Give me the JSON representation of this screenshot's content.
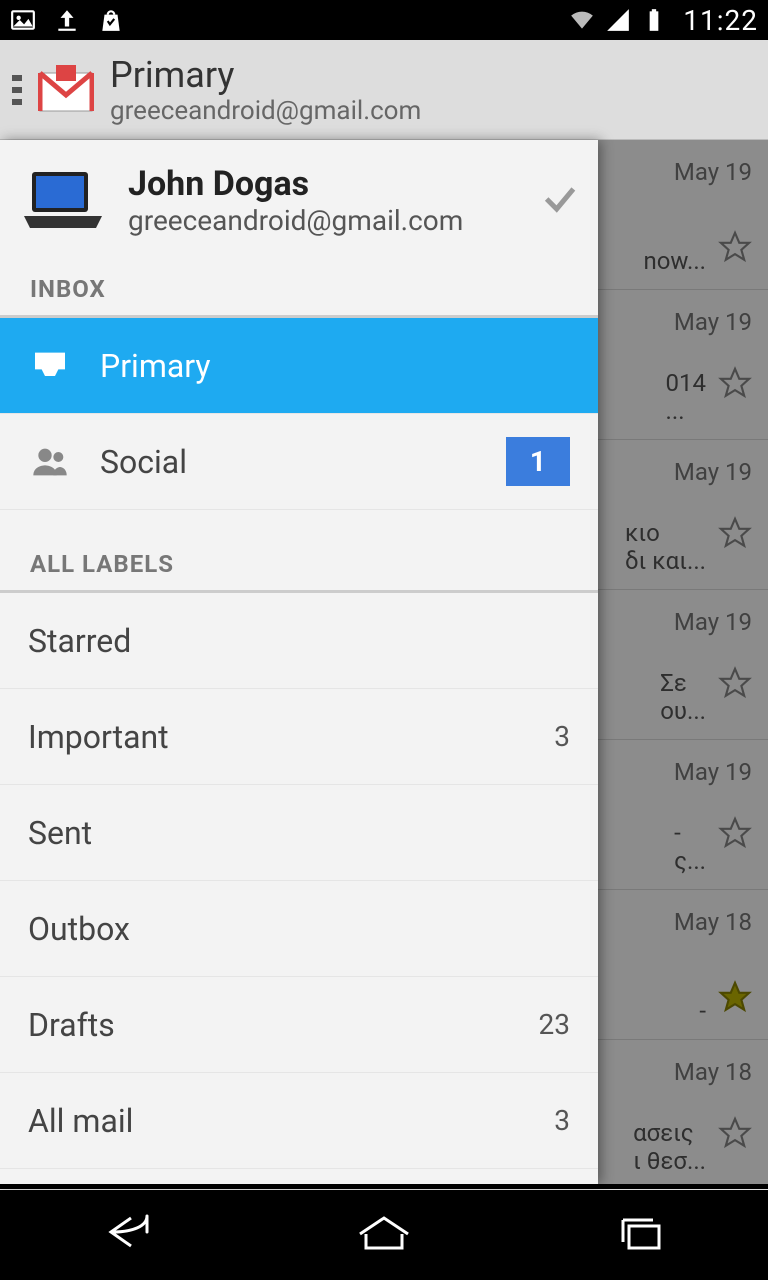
{
  "status": {
    "time": "11:22"
  },
  "header": {
    "title": "Primary",
    "subtitle": "greeceandroid@gmail.com"
  },
  "drawer": {
    "account": {
      "name": "John Dogas",
      "email": "greeceandroid@gmail.com"
    },
    "section_inbox": "INBOX",
    "inbox_items": [
      {
        "label": "Primary",
        "selected": true
      },
      {
        "label": "Social",
        "badge": "1"
      }
    ],
    "section_labels": "ALL LABELS",
    "label_items": [
      {
        "label": "Starred"
      },
      {
        "label": "Important",
        "count": "3"
      },
      {
        "label": "Sent"
      },
      {
        "label": "Outbox"
      },
      {
        "label": "Drafts",
        "count": "23"
      },
      {
        "label": "All mail",
        "count": "3"
      }
    ]
  },
  "bg_rows": [
    {
      "date": "May 19",
      "snip": "now..."
    },
    {
      "date": "May 19",
      "snip": "014\n..."
    },
    {
      "date": "May 19",
      "snip": "κιο\nδι και..."
    },
    {
      "date": "May 19",
      "snip": "Σε\nου..."
    },
    {
      "date": "May 19",
      "snip": "-\nς..."
    },
    {
      "date": "May 18",
      "snip": "-",
      "starred": true
    },
    {
      "date": "May 18",
      "snip": "ασεις\nι θεσ..."
    }
  ]
}
